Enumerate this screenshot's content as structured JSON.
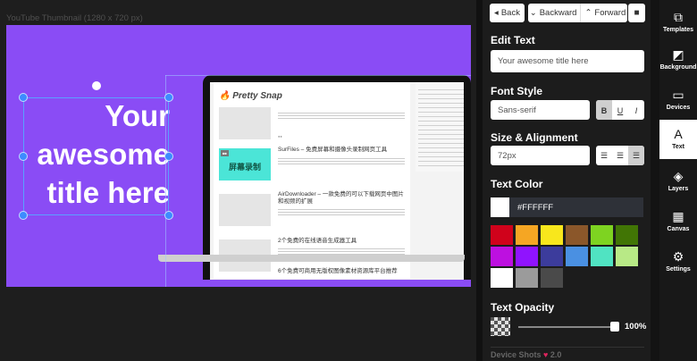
{
  "canvas": {
    "label": "YouTube Thumbnail (1280 x 720 px)",
    "background": "#8a4cf5",
    "title_line1": "Your",
    "title_line2": "awesome",
    "title_line3": "title here",
    "mock_site": {
      "logo": "Pretty Snap",
      "teal_thumb_text": "屏幕录制",
      "articles": [
        {
          "title": "SurFiles – 免费屏幕和摄像头录制网页工具"
        },
        {
          "title": "AirDownloader – 一款免费的可以下载网页中图片和视频的扩展"
        },
        {
          "title": "2个免费的在线语音生成器工具"
        },
        {
          "title": "6个免费可商用无版权图像素材资源库平台推荐"
        }
      ]
    }
  },
  "toolbar": {
    "back": "Back",
    "backward": "Backward",
    "forward": "Forward"
  },
  "edit_text": {
    "heading": "Edit Text",
    "value": "Your awesome title here"
  },
  "font_style": {
    "heading": "Font Style",
    "family": "Sans-serif",
    "bold": "B",
    "underline": "U",
    "italic": "I"
  },
  "size_alignment": {
    "heading": "Size & Alignment",
    "size": "72px"
  },
  "text_color": {
    "heading": "Text Color",
    "hex": "#FFFFFF",
    "swatches": [
      "#d0021b",
      "#f5a623",
      "#f8e71c",
      "#8b572a",
      "#7ed321",
      "#417505",
      "#bd10e0",
      "#9013fe",
      "#3c3c9c",
      "#4a90e2",
      "#50e3c2",
      "#b8e986",
      "#ffffff",
      "#9b9b9b",
      "#4a4a4a"
    ]
  },
  "text_opacity": {
    "heading": "Text Opacity",
    "value": "100%",
    "level": 1.0
  },
  "footer": {
    "label": "Device Shots",
    "heart": "♥",
    "version": "2.0"
  },
  "sidebar": {
    "items": [
      {
        "label": "Templates",
        "icon": "⧉"
      },
      {
        "label": "Background",
        "icon": "◩"
      },
      {
        "label": "Devices",
        "icon": "▭"
      },
      {
        "label": "Text",
        "icon": "A"
      },
      {
        "label": "Layers",
        "icon": "◈"
      },
      {
        "label": "Canvas",
        "icon": "▦"
      },
      {
        "label": "Settings",
        "icon": "⚙"
      }
    ]
  }
}
